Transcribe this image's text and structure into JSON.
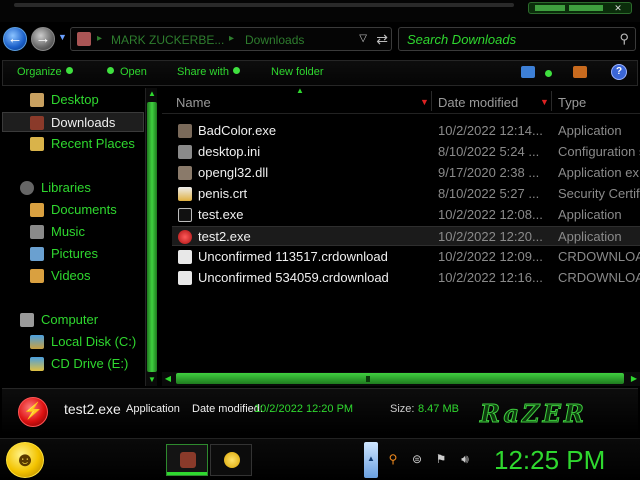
{
  "window": {
    "address": {
      "crumbs": [
        "MARK ZUCKERBE...",
        "Downloads"
      ]
    },
    "search": {
      "placeholder": "Search Downloads"
    }
  },
  "toolbar": {
    "organize_label": "Organize",
    "open_label": "Open",
    "share_label": "Share with",
    "new_folder_label": "New folder"
  },
  "nav_pane": {
    "items": [
      {
        "label": "Desktop",
        "icon": "desktop-icon"
      },
      {
        "label": "Downloads",
        "icon": "downloads-folder-icon",
        "selected": true
      },
      {
        "label": "Recent Places",
        "icon": "recent-places-icon"
      },
      {
        "label": "Libraries",
        "icon": "libraries-icon"
      },
      {
        "label": "Documents",
        "icon": "documents-icon"
      },
      {
        "label": "Music",
        "icon": "music-icon"
      },
      {
        "label": "Pictures",
        "icon": "pictures-icon"
      },
      {
        "label": "Videos",
        "icon": "videos-icon"
      },
      {
        "label": "Computer",
        "icon": "computer-icon"
      },
      {
        "label": "Local Disk (C:)",
        "icon": "hard-disk-icon"
      },
      {
        "label": "CD Drive (E:)",
        "icon": "cd-drive-icon"
      }
    ]
  },
  "file_list": {
    "columns": [
      "Name",
      "Date modified",
      "Type"
    ],
    "rows": [
      {
        "name": "BadColor.exe",
        "date": "10/2/2022 12:14...",
        "type": "Application",
        "icon": "exe-icon"
      },
      {
        "name": "desktop.ini",
        "date": "8/10/2022 5:24 ...",
        "type": "Configuration s",
        "icon": "settings-file-icon"
      },
      {
        "name": "opengl32.dll",
        "date": "9/17/2020 2:38 ...",
        "type": "Application ex",
        "icon": "dll-icon"
      },
      {
        "name": "penis.crt",
        "date": "8/10/2022 5:27 ...",
        "type": "Security Certif",
        "icon": "certificate-icon"
      },
      {
        "name": "test.exe",
        "date": "10/2/2022 12:08...",
        "type": "Application",
        "icon": "console-icon"
      },
      {
        "name": "test2.exe",
        "date": "10/2/2022 12:20...",
        "type": "Application",
        "icon": "red-app-icon",
        "selected": true
      },
      {
        "name": "Unconfirmed 113517.crdownload",
        "date": "10/2/2022 12:09...",
        "type": "CRDOWNLOA",
        "icon": "file-icon"
      },
      {
        "name": "Unconfirmed 534059.crdownload",
        "date": "10/2/2022 12:16...",
        "type": "CRDOWNLOA",
        "icon": "file-icon"
      }
    ]
  },
  "details": {
    "file_name": "test2.exe",
    "file_type": "Application",
    "date_label": "Date modified:",
    "date_value": "10/2/2022 12:20 PM",
    "size_label": "Size:",
    "size_value": "8.47 MB",
    "logo_text": "RaZER"
  },
  "taskbar": {
    "clock": "12:25 PM"
  },
  "colors": {
    "accent": "#2fd82f",
    "background": "#000000",
    "sort_arrow": "#dd2222"
  }
}
